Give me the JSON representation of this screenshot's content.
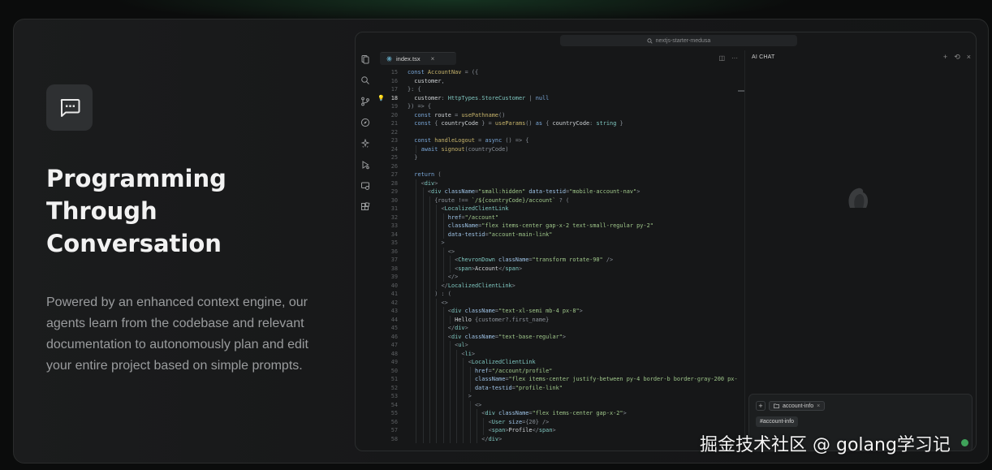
{
  "feature": {
    "headline_lines": [
      "Programming",
      "Through",
      "Conversation"
    ],
    "description": "Powered by an enhanced context engine, our agents learn from the codebase and relevant documentation to autonomously plan and edit your entire project based on simple prompts.",
    "icon": "chat-bubble-icon"
  },
  "ide": {
    "search_text": "nextjs-starter-medusa",
    "activity_icons": [
      "files-icon",
      "search-icon",
      "source-control-icon",
      "compass-icon",
      "extensions-icon",
      "run-debug-icon",
      "remote-explorer-icon",
      "grid-icon"
    ],
    "tab": {
      "label": "index.tsx",
      "close": "×"
    },
    "tab_actions": [
      "◫",
      "···"
    ],
    "active_line": 18,
    "code": [
      {
        "n": 15,
        "i": 0,
        "h": "<span class='k'>const</span> <span class='f'>AccountNav</span> <span class='p'>= ({</span>"
      },
      {
        "n": 16,
        "i": 1,
        "h": "customer<span class='p'>,</span>"
      },
      {
        "n": 17,
        "i": 0,
        "h": "<span class='p'>}: {</span>"
      },
      {
        "n": 18,
        "i": 1,
        "h": "customer<span class='p'>:</span> <span class='t'>HttpTypes</span><span class='p'>.</span><span class='t'>StoreCustomer</span> <span class='p'>|</span> <span class='k'>null</span>"
      },
      {
        "n": 19,
        "i": 0,
        "h": "<span class='p'>}) => {</span>"
      },
      {
        "n": 20,
        "i": 1,
        "h": "<span class='k'>const</span> route <span class='p'>=</span> <span class='f'>usePathname</span><span class='p'>()</span>"
      },
      {
        "n": 21,
        "i": 1,
        "h": "<span class='k'>const</span> <span class='p'>{</span> countryCode <span class='p'>} =</span> <span class='f'>useParams</span><span class='p'>()</span> <span class='k'>as</span> <span class='p'>{</span> countryCode<span class='p'>:</span> <span class='t'>string</span> <span class='p'>}</span>"
      },
      {
        "n": 22,
        "i": 0,
        "h": ""
      },
      {
        "n": 23,
        "i": 1,
        "h": "<span class='k'>const</span> <span class='f'>handleLogout</span> <span class='p'>=</span> <span class='k'>async</span> <span class='p'>() => {</span>"
      },
      {
        "n": 24,
        "i": 2,
        "h": "<span class='k'>await</span> <span class='f'>signout</span><span class='p'>(countryCode)</span>"
      },
      {
        "n": 25,
        "i": 1,
        "h": "<span class='p'>}</span>"
      },
      {
        "n": 26,
        "i": 0,
        "h": ""
      },
      {
        "n": 27,
        "i": 1,
        "h": "<span class='k'>return</span> <span class='p'>(</span>"
      },
      {
        "n": 28,
        "i": 2,
        "h": "<span class='p'>&lt;</span><span class='t'>div</span><span class='p'>&gt;</span>"
      },
      {
        "n": 29,
        "i": 3,
        "h": "<span class='p'>&lt;</span><span class='t'>div</span> <span class='a'>className</span><span class='p'>=</span><span class='s'>\"small:hidden\"</span> <span class='a'>data-testid</span><span class='p'>=</span><span class='s'>\"mobile-account-nav\"</span><span class='p'>&gt;</span>"
      },
      {
        "n": 30,
        "i": 4,
        "h": "<span class='p'>{route !==</span> <span class='s'>`/${countryCode}/account`</span> <span class='p'>? (</span>"
      },
      {
        "n": 31,
        "i": 5,
        "h": "<span class='p'>&lt;</span><span class='t'>LocalizedClientLink</span>"
      },
      {
        "n": 32,
        "i": 6,
        "h": "<span class='a'>href</span><span class='p'>=</span><span class='s'>\"/account\"</span>"
      },
      {
        "n": 33,
        "i": 6,
        "h": "<span class='a'>className</span><span class='p'>=</span><span class='s'>\"flex items-center gap-x-2 text-small-regular py-2\"</span>"
      },
      {
        "n": 34,
        "i": 6,
        "h": "<span class='a'>data-testid</span><span class='p'>=</span><span class='s'>\"account-main-link\"</span>"
      },
      {
        "n": 35,
        "i": 5,
        "h": "<span class='p'>&gt;</span>"
      },
      {
        "n": 36,
        "i": 6,
        "h": "<span class='p'>&lt;&gt;</span>"
      },
      {
        "n": 37,
        "i": 7,
        "h": "<span class='p'>&lt;</span><span class='t'>ChevronDown</span> <span class='a'>className</span><span class='p'>=</span><span class='s'>\"transform rotate-90\"</span> <span class='p'>/&gt;</span>"
      },
      {
        "n": 38,
        "i": 7,
        "h": "<span class='p'>&lt;</span><span class='t'>span</span><span class='p'>&gt;</span>Account<span class='p'>&lt;/</span><span class='t'>span</span><span class='p'>&gt;</span>"
      },
      {
        "n": 39,
        "i": 6,
        "h": "<span class='p'>&lt;/&gt;</span>"
      },
      {
        "n": 40,
        "i": 5,
        "h": "<span class='p'>&lt;/</span><span class='t'>LocalizedClientLink</span><span class='p'>&gt;</span>"
      },
      {
        "n": 41,
        "i": 4,
        "h": "<span class='p'>) : (</span>"
      },
      {
        "n": 42,
        "i": 5,
        "h": "<span class='p'>&lt;&gt;</span>"
      },
      {
        "n": 43,
        "i": 6,
        "h": "<span class='p'>&lt;</span><span class='t'>div</span> <span class='a'>className</span><span class='p'>=</span><span class='s'>\"text-xl-semi mb-4 px-8\"</span><span class='p'>&gt;</span>"
      },
      {
        "n": 44,
        "i": 7,
        "h": "Hello <span class='p'>{customer?.first_name}</span>"
      },
      {
        "n": 45,
        "i": 6,
        "h": "<span class='p'>&lt;/</span><span class='t'>div</span><span class='p'>&gt;</span>"
      },
      {
        "n": 46,
        "i": 6,
        "h": "<span class='p'>&lt;</span><span class='t'>div</span> <span class='a'>className</span><span class='p'>=</span><span class='s'>\"text-base-regular\"</span><span class='p'>&gt;</span>"
      },
      {
        "n": 47,
        "i": 7,
        "h": "<span class='p'>&lt;</span><span class='t'>ul</span><span class='p'>&gt;</span>"
      },
      {
        "n": 48,
        "i": 8,
        "h": "<span class='p'>&lt;</span><span class='t'>li</span><span class='p'>&gt;</span>"
      },
      {
        "n": 49,
        "i": 9,
        "h": "<span class='p'>&lt;</span><span class='t'>LocalizedClientLink</span>"
      },
      {
        "n": 50,
        "i": 10,
        "h": "<span class='a'>href</span><span class='p'>=</span><span class='s'>\"/account/profile\"</span>"
      },
      {
        "n": 51,
        "i": 10,
        "h": "<span class='a'>className</span><span class='p'>=</span><span class='s'>\"flex items-center justify-between py-4 border-b border-gray-200 px-</span>"
      },
      {
        "n": 52,
        "i": 10,
        "h": "<span class='a'>data-testid</span><span class='p'>=</span><span class='s'>\"profile-link\"</span>"
      },
      {
        "n": 53,
        "i": 9,
        "h": "<span class='p'>&gt;</span>"
      },
      {
        "n": 54,
        "i": 10,
        "h": "<span class='p'>&lt;&gt;</span>"
      },
      {
        "n": 55,
        "i": 11,
        "h": "<span class='p'>&lt;</span><span class='t'>div</span> <span class='a'>className</span><span class='p'>=</span><span class='s'>\"flex items-center gap-x-2\"</span><span class='p'>&gt;</span>"
      },
      {
        "n": 56,
        "i": 12,
        "h": "<span class='p'>&lt;</span><span class='t'>User</span> <span class='a'>size</span><span class='p'>={20} /&gt;</span>"
      },
      {
        "n": 57,
        "i": 12,
        "h": "<span class='p'>&lt;</span><span class='t'>span</span><span class='p'>&gt;</span>Profile<span class='p'>&lt;/</span><span class='t'>span</span><span class='p'>&gt;</span>"
      },
      {
        "n": 58,
        "i": 11,
        "h": "<span class='p'>&lt;/</span><span class='t'>div</span><span class='p'>&gt;</span>"
      }
    ]
  },
  "chat": {
    "title": "AI CHAT",
    "actions": [
      "+",
      "⟲",
      "×"
    ],
    "composer": {
      "add_label": "+",
      "chip_label": "account-info",
      "chip_close": "×",
      "mention": "#account-info"
    }
  },
  "watermark": "掘金技术社区 @ golang学习记",
  "colors": {
    "accent_green": "#3fa35a",
    "keyword": "#7aa7d8",
    "string": "#9fc68a",
    "type": "#7fc7c0"
  }
}
